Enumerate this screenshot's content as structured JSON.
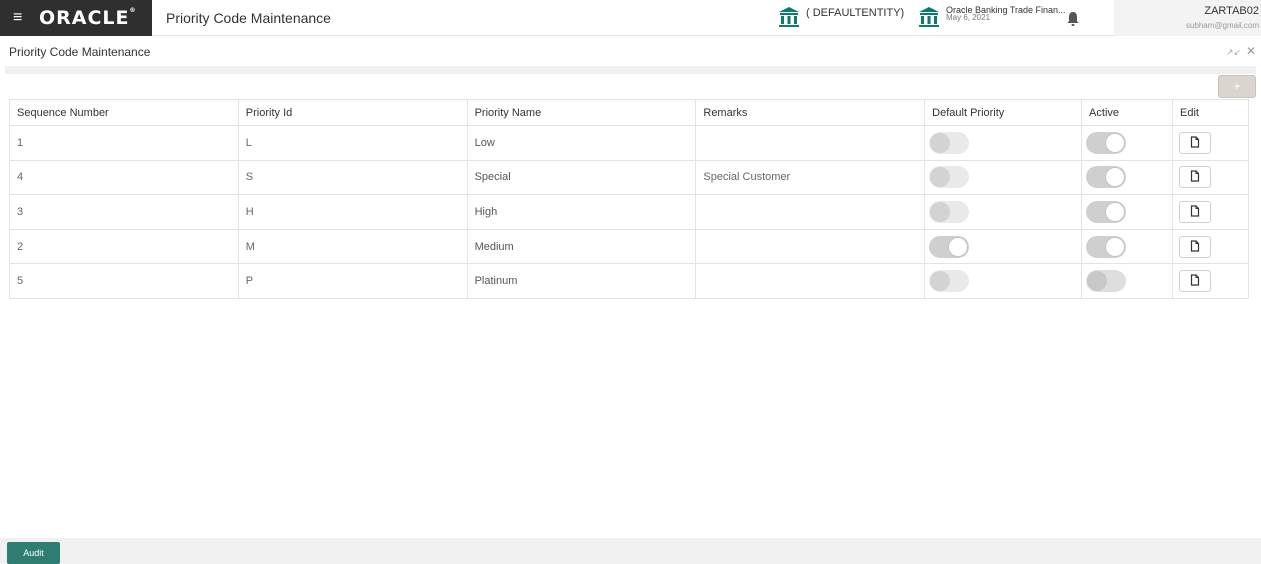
{
  "header": {
    "menu_icon": "hamburger-icon",
    "brand": "ORACLE",
    "app_title": "Priority Code Maintenance",
    "entity": "( DEFAULTENTITY)",
    "branch_name": "Oracle Banking Trade Finan...",
    "branch_date": "May 6, 2021",
    "user_id": "ZARTAB02",
    "user_email": "subham@gmail.com",
    "colors": {
      "brand_bg": "#2f2f2f",
      "bank_icon": "#0c7a6e"
    }
  },
  "page": {
    "title": "Priority Code Maintenance",
    "add_label": "+"
  },
  "table": {
    "columns": [
      "Sequence Number",
      "Priority Id",
      "Priority Name",
      "Remarks",
      "Default Priority",
      "Active",
      "Edit"
    ],
    "rows": [
      {
        "sequence": "1",
        "id": "L",
        "name": "Low",
        "remarks": "",
        "default_priority": false,
        "active": true
      },
      {
        "sequence": "4",
        "id": "S",
        "name": "Special",
        "remarks": "Special Customer",
        "default_priority": false,
        "active": true
      },
      {
        "sequence": "3",
        "id": "H",
        "name": "High",
        "remarks": "",
        "default_priority": false,
        "active": true
      },
      {
        "sequence": "2",
        "id": "M",
        "name": "Medium",
        "remarks": "",
        "default_priority": true,
        "active": true
      },
      {
        "sequence": "5",
        "id": "P",
        "name": "Platinum",
        "remarks": "",
        "default_priority": false,
        "active": false
      }
    ]
  },
  "footer": {
    "audit_label": "Audit",
    "colors": {
      "audit_bg": "#2e7d71"
    }
  }
}
